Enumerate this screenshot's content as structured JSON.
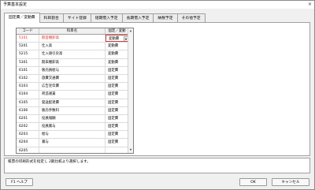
{
  "window": {
    "title": "予算基本設定",
    "close_glyph": "×"
  },
  "tabs": [
    {
      "label": "固定費／変動費",
      "active": true
    },
    {
      "label": "科目割合",
      "active": false
    },
    {
      "label": "サイト登録",
      "active": false
    },
    {
      "label": "短期借入予定",
      "active": false
    },
    {
      "label": "長期借入予定",
      "active": false
    },
    {
      "label": "納税予定",
      "active": false
    },
    {
      "label": "その他予定",
      "active": false
    }
  ],
  "grid": {
    "headers": {
      "code": "コード",
      "name": "科目名",
      "type": "固定／変動"
    },
    "rows": [
      {
        "code": "5101",
        "name": "期首棚卸高",
        "type": "変動費",
        "selected": true
      },
      {
        "code": "5201",
        "name": "仕入高",
        "type": "変動費",
        "selected": false
      },
      {
        "code": "5215",
        "name": "仕入値引戻高",
        "type": "変動費",
        "selected": false
      },
      {
        "code": "5301",
        "name": "期末棚卸高",
        "type": "変動費",
        "selected": false
      },
      {
        "code": "6101",
        "name": "販売員給与",
        "type": "固定費",
        "selected": false
      },
      {
        "code": "6102",
        "name": "旅費交通費",
        "type": "固定費",
        "selected": false
      },
      {
        "code": "6103",
        "name": "広告宣伝費",
        "type": "固定費",
        "selected": false
      },
      {
        "code": "6104",
        "name": "荷造運賃",
        "type": "固定費",
        "selected": false
      },
      {
        "code": "6105",
        "name": "発送配達費",
        "type": "固定費",
        "selected": false
      },
      {
        "code": "6106",
        "name": "販売手数料",
        "type": "固定費",
        "selected": false
      },
      {
        "code": "6201",
        "name": "役員報酬",
        "type": "固定費",
        "selected": false
      },
      {
        "code": "6202",
        "name": "役員賞与",
        "type": "固定費",
        "selected": false
      },
      {
        "code": "6203",
        "name": "給与",
        "type": "固定費",
        "selected": false
      },
      {
        "code": "6204",
        "name": "賞与",
        "type": "固定費",
        "selected": false
      },
      {
        "code": "6205",
        "name": "",
        "type": "",
        "selected": false
      }
    ],
    "dropdown_glyph": "▼",
    "scroll_up_glyph": "▲",
    "scroll_down_glyph": "▼"
  },
  "note": "帳票の印刷形式を指定し 2期比較より選択します。",
  "buttons": {
    "help": "F1 ヘルプ",
    "ok": "OK",
    "cancel": "キャンセル"
  }
}
